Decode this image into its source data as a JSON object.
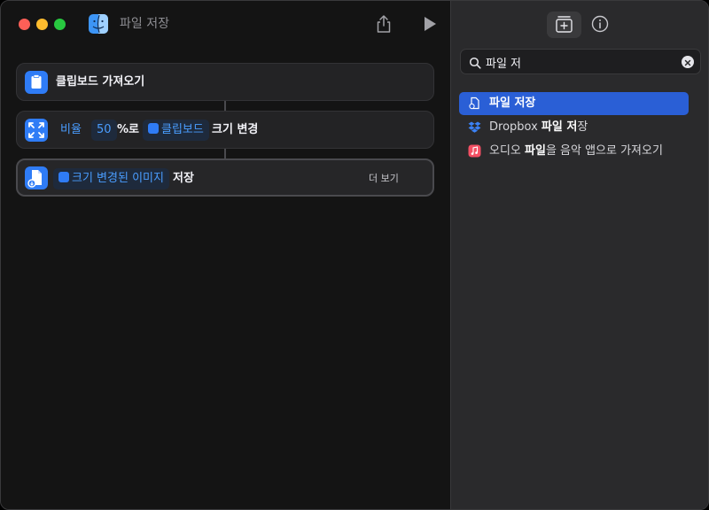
{
  "window": {
    "title": "파일 저장"
  },
  "toolbar": {
    "share_icon": "share-icon",
    "run_icon": "play-icon"
  },
  "actions": [
    {
      "label": "클립보드 가져오기",
      "icon": "clipboard-icon",
      "color": "#2f7cf6"
    },
    {
      "prefix": "비율",
      "value": "50",
      "unit": "%로",
      "variable": "클립보드",
      "suffix": "크기 변경",
      "icon": "resize-icon",
      "color": "#2f7cf6"
    },
    {
      "variable": "크기 변경된 이미지",
      "verb": "저장",
      "more": "더 보기",
      "icon": "save-file-icon",
      "color": "#2f7cf6"
    }
  ],
  "sidebar": {
    "tab_add_icon": "add-action-icon",
    "tab_info_icon": "info-icon",
    "search": {
      "value": "파일 저",
      "placeholder": ""
    },
    "results": [
      {
        "match": "파일 저",
        "rest": "장",
        "icon": "file-icon",
        "selected": true
      },
      {
        "pre": "Dropbox ",
        "match": "파일 저",
        "rest": "장",
        "icon": "dropbox-icon",
        "selected": false
      },
      {
        "pre": "오디오 ",
        "match": "파일",
        "rest": "을 음악 앱으로 가져오기",
        "icon": "music-icon",
        "selected": false
      }
    ]
  },
  "colors": {
    "accent": "#2a5fd6",
    "token_text": "#4a9dff"
  }
}
